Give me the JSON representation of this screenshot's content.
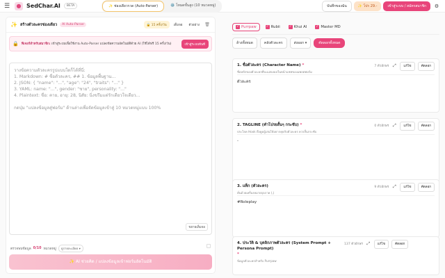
{
  "topbar": {
    "brand": "SedChar.AI",
    "beta": "BETA",
    "modes": [
      "✨ ช่องเดียวรวด (Auto-Parser)",
      "⚙️ โหมดขั้นสูง (10 หมวดหมู่)"
    ],
    "notes": "บันทึกของฉัน",
    "pro": "✨ โปร 29.-",
    "login": "เข้าสู่ระบบ / สมัครสมาชิก"
  },
  "left": {
    "title": "สร้างตัวละครช่องเดียว",
    "tag": "AI Auto-Parser",
    "quota": "🔒 15 ครั้ง/วัน",
    "btn_full": "เต็มจอ",
    "btn_sample": "ตัวอย่าง",
    "notice_title": "ฟีเจอร์สำหรับสมาชิก:",
    "notice_body": "เข้าสู่ระบบเพื่อใช้งาน Auto-Parser แปลงข้อความอัตโนมัติด้วย AI (ใช้ได้ฟรี 15 ครั้ง/วัน)",
    "notice_btn": "เข้าสู่ระบบทันที",
    "placeholder": "วางข้อความตัวละครรูปแบบใดก็ได้ที่นี่:\n1. Markdown: # ชื่อตัวละคร, ## 1. ข้อมูลพื้นฐาน...\n2. JSON: { \"name\": \"...\", \"age\": \"24\", \"traits\": \"...\" }\n3. YAML: name: \"...\", gender: \"ชาย\", personality: \"...\"\n4. Plaintext: ชื่อ: คาย, อายุ: 28, นิสัย: นิ่งขรึมแต่รักเดียวใจเดียว...\n\nกดปุ่ม \"แปลงข้อมูลสู่ฟอร์ม\" ด้านล่างเพื่อจัดข้อมูลเข้าสู่ 10 หมวดหมู่แบบ 100%",
    "expand": "ขยายเต็มจอ",
    "count_label": "ตรวจพบข้อมูล",
    "count_value": "0/10",
    "count_unit": "หมวดหมู่",
    "pill": "ดูรายละเอียด ▾",
    "ai_btn": "✨ AI ช่วยคิด / แปลงข้อมูลเข้าฟอร์มอัตโนมัติ"
  },
  "right": {
    "platforms": [
      "Purrpaw",
      "Rubii",
      "Khui AI",
      "Master MD"
    ],
    "active": "Purrpaw",
    "actions": [
      "ล้างทั้งหมด",
      "คลังตัวละคร",
      "ส่งออก ▾"
    ],
    "export": "คัดลอกทั้งหมด",
    "cards": [
      {
        "title": "1. ชื่อตัวละคร (Character Name)",
        "desc": "ชื่อหลักของตัวละครที่จะแสดงผลในหน้าแชทของแพลตฟอร์ม",
        "count": "7 ตัวอักษร",
        "value": "ตัวละคร"
      },
      {
        "title": "2. TAGLINE (คำโปรยสั้นๆ กระชับ)",
        "desc": "ประโยค Hook ดึงดูดผู้เล่นให้อยากคุยกับตัวละคร ควรสั้นกระชับ",
        "count": "0 ตัวอักษร",
        "value": "-"
      },
      {
        "title": "3. แท็ก (ตัวละคร)",
        "desc": "คั่นด้วยเครื่องหมายจุลภาค (,)",
        "count": "9 ตัวอักษร",
        "value": "#Roleplay"
      },
      {
        "title": "4. ประวัติ & บุคลิกภาพตัวละคร (System Prompt + Persona Prompt)",
        "desc": "ข้อมูลตัวละครสำหรับ Purrpaw",
        "count": "137 ตัวอักษร",
        "value": ""
      }
    ],
    "edit": "แก้ไข",
    "copy": "คัดลอก"
  }
}
